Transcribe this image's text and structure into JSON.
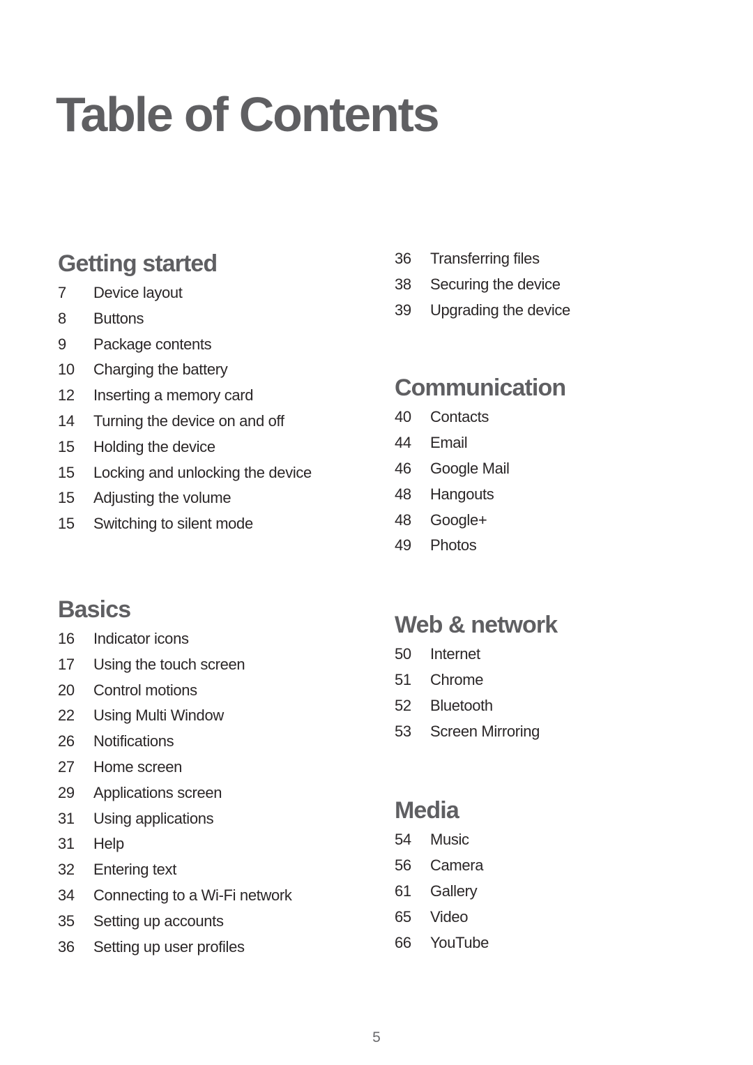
{
  "title": "Table of Contents",
  "left_column": {
    "sections": [
      {
        "heading": "Getting started",
        "entries": [
          {
            "page": "7",
            "label": "Device layout"
          },
          {
            "page": "8",
            "label": "Buttons"
          },
          {
            "page": "9",
            "label": "Package contents"
          },
          {
            "page": "10",
            "label": "Charging the battery"
          },
          {
            "page": "12",
            "label": "Inserting a memory card"
          },
          {
            "page": "14",
            "label": "Turning the device on and off"
          },
          {
            "page": "15",
            "label": "Holding the device"
          },
          {
            "page": "15",
            "label": "Locking and unlocking the device"
          },
          {
            "page": "15",
            "label": "Adjusting the volume"
          },
          {
            "page": "15",
            "label": "Switching to silent mode"
          }
        ]
      },
      {
        "heading": "Basics",
        "entries": [
          {
            "page": "16",
            "label": "Indicator icons"
          },
          {
            "page": "17",
            "label": "Using the touch screen"
          },
          {
            "page": "20",
            "label": "Control motions"
          },
          {
            "page": "22",
            "label": "Using Multi Window"
          },
          {
            "page": "26",
            "label": "Notifications"
          },
          {
            "page": "27",
            "label": "Home screen"
          },
          {
            "page": "29",
            "label": "Applications screen"
          },
          {
            "page": "31",
            "label": "Using applications"
          },
          {
            "page": "31",
            "label": "Help"
          },
          {
            "page": "32",
            "label": "Entering text"
          },
          {
            "page": "34",
            "label": "Connecting to a Wi-Fi network"
          },
          {
            "page": "35",
            "label": "Setting up accounts"
          },
          {
            "page": "36",
            "label": "Setting up user profiles"
          }
        ]
      }
    ]
  },
  "right_column": {
    "continued_entries": [
      {
        "page": "36",
        "label": "Transferring files"
      },
      {
        "page": "38",
        "label": "Securing the device"
      },
      {
        "page": "39",
        "label": "Upgrading the device"
      }
    ],
    "sections": [
      {
        "heading": "Communication",
        "entries": [
          {
            "page": "40",
            "label": "Contacts"
          },
          {
            "page": "44",
            "label": "Email"
          },
          {
            "page": "46",
            "label": "Google Mail"
          },
          {
            "page": "48",
            "label": "Hangouts"
          },
          {
            "page": "48",
            "label": "Google+"
          },
          {
            "page": "49",
            "label": "Photos"
          }
        ]
      },
      {
        "heading": "Web & network",
        "entries": [
          {
            "page": "50",
            "label": "Internet"
          },
          {
            "page": "51",
            "label": "Chrome"
          },
          {
            "page": "52",
            "label": "Bluetooth"
          },
          {
            "page": "53",
            "label": "Screen Mirroring"
          }
        ]
      },
      {
        "heading": "Media",
        "entries": [
          {
            "page": "54",
            "label": "Music"
          },
          {
            "page": "56",
            "label": "Camera"
          },
          {
            "page": "61",
            "label": "Gallery"
          },
          {
            "page": "65",
            "label": "Video"
          },
          {
            "page": "66",
            "label": "YouTube"
          }
        ]
      }
    ]
  },
  "footer": {
    "page_number": "5"
  }
}
